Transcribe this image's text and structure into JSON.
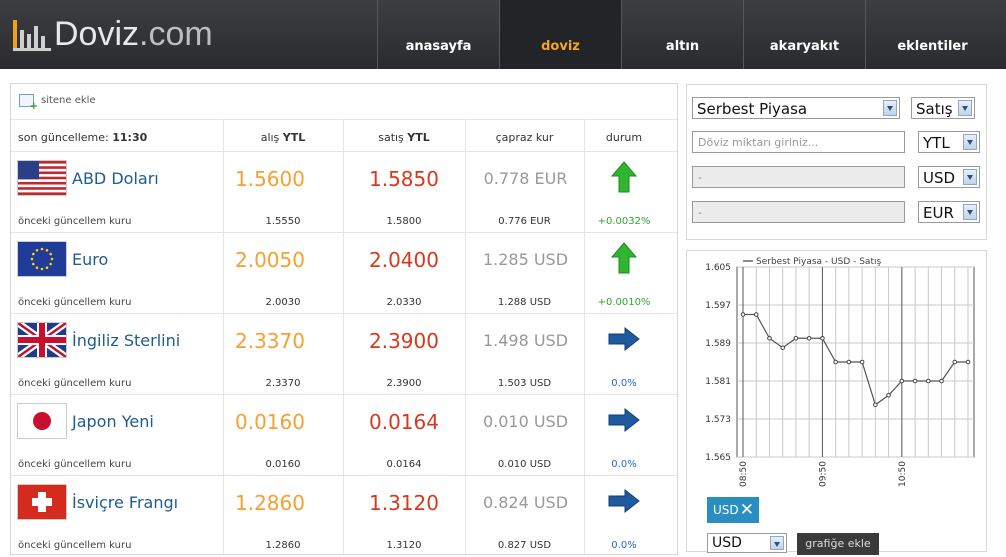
{
  "logo": {
    "text_main": "Doviz",
    "text_suffix": ".com"
  },
  "nav": [
    "anasayfa",
    "doviz",
    "altın",
    "akaryakıt",
    "eklentiler"
  ],
  "nav_active_index": 1,
  "left": {
    "add_site": "sitene ekle",
    "last_update_label": "son güncelleme:",
    "last_update_time": "11:30",
    "col_buy": "alış",
    "col_sell": "satış",
    "col_unit": "YTL",
    "col_cross": "çapraz kur",
    "col_status": "durum",
    "prev_label": "önceki güncellem kuru",
    "rows": [
      {
        "name": "ABD Doları",
        "flag": "us-flag",
        "buy": "1.5600",
        "sell": "1.5850",
        "cross": "0.778 EUR",
        "prev_buy": "1.5550",
        "prev_sell": "1.5800",
        "prev_cross": "0.776 EUR",
        "status_icon": "arrow-up-green",
        "status_text": "+0.0032%"
      },
      {
        "name": "Euro",
        "flag": "eu-flag",
        "buy": "2.0050",
        "sell": "2.0400",
        "cross": "1.285 USD",
        "prev_buy": "2.0030",
        "prev_sell": "2.0330",
        "prev_cross": "1.288 USD",
        "status_icon": "arrow-up-green",
        "status_text": "+0.0010%"
      },
      {
        "name": "İngiliz Sterlini",
        "flag": "uk-flag",
        "buy": "2.3370",
        "sell": "2.3900",
        "cross": "1.498 USD",
        "prev_buy": "2.3370",
        "prev_sell": "2.3900",
        "prev_cross": "1.503 USD",
        "status_icon": "arrow-right-blue",
        "status_text": "0.0%"
      },
      {
        "name": "Japon Yeni",
        "flag": "jp-flag",
        "buy": "0.0160",
        "sell": "0.0164",
        "cross": "0.010 USD",
        "prev_buy": "0.0160",
        "prev_sell": "0.0164",
        "prev_cross": "0.010 USD",
        "status_icon": "arrow-right-blue",
        "status_text": "0.0%"
      },
      {
        "name": "İsviçre Frangı",
        "flag": "ch-flag",
        "buy": "1.2860",
        "sell": "1.3120",
        "cross": "0.824 USD",
        "prev_buy": "1.2860",
        "prev_sell": "1.3120",
        "prev_cross": "0.827 USD",
        "status_icon": "arrow-right-blue",
        "status_text": "0.0%"
      }
    ]
  },
  "converter": {
    "market": "Serbest Piyasa",
    "side": "Satış",
    "amount_placeholder": "Döviz miktarı giriniz...",
    "from_currency": "YTL",
    "out1_value": "-",
    "out1_currency": "USD",
    "out2_value": "-",
    "out2_currency": "EUR"
  },
  "chart_controls": {
    "tag_label": "USD",
    "select_value": "USD",
    "add_button": "grafiğe ekle"
  },
  "colors": {
    "header": "#2f3034",
    "active_nav": "#f5a623",
    "buy": "#f5a030",
    "sell": "#d63a1e",
    "name": "#1f5c8f",
    "up": "#2fa52f",
    "flat": "#1f6cc4"
  },
  "chart_data": {
    "type": "line",
    "legend": "Serbest Piyasa - USD - Satış",
    "ylim": [
      1.565,
      1.605
    ],
    "yticks": [
      "1.605",
      "1.597",
      "1.589",
      "1.581",
      "1.573",
      "1.565"
    ],
    "xticks": [
      "08:50",
      "09:50",
      "10:50"
    ],
    "series": [
      {
        "name": "Serbest Piyasa - USD - Satış",
        "values": [
          1.595,
          1.595,
          1.59,
          1.588,
          1.59,
          1.59,
          1.59,
          1.585,
          1.585,
          1.585,
          1.576,
          1.578,
          1.581,
          1.581,
          1.581,
          1.581,
          1.585,
          1.585
        ]
      }
    ],
    "grid": true
  }
}
